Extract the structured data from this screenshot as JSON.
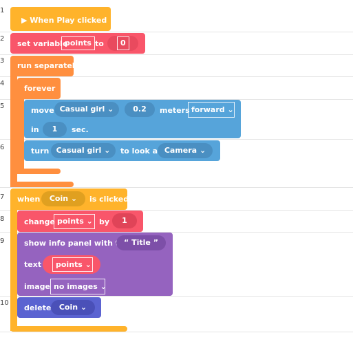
{
  "line_numbers": [
    "1",
    "2",
    "3",
    "4",
    "5",
    "6",
    "7",
    "8",
    "9",
    "10"
  ],
  "blocks": {
    "when_play": "▶ When Play clicked",
    "set_var": {
      "label": "set variable",
      "var": "points",
      "to": "to",
      "value": "0"
    },
    "run_sep": "run separately",
    "forever": "forever",
    "move": {
      "label": "move",
      "target": "Casual girl ⌄",
      "amount": "0.2",
      "unit": "meters",
      "dir": "forward ⌄",
      "in": "in",
      "time": "1",
      "sec": "sec."
    },
    "turn": {
      "label": "turn",
      "target": "Casual girl ⌄",
      "look": "to look at",
      "object": "Camera ⌄"
    },
    "when_click": {
      "when": "when",
      "target": "Coin ⌄",
      "clicked": "is clicked"
    },
    "change": {
      "label": "change",
      "var": "points ⌄",
      "by": "by",
      "value": "1"
    },
    "info": {
      "label": "show info panel with title",
      "title": "“  Title  ”",
      "text": "text",
      "text_var": "points ⌄",
      "image": "image",
      "image_val": "no images ⌄"
    },
    "delete": {
      "label": "delete",
      "target": "Coin ⌄"
    }
  },
  "colors": {
    "event": "#FFB32B",
    "variable": "#F9566A",
    "control": "#FF8F3F",
    "motion": "#56A4DA",
    "looks": "#9563BF",
    "object": "#5B63D1"
  }
}
